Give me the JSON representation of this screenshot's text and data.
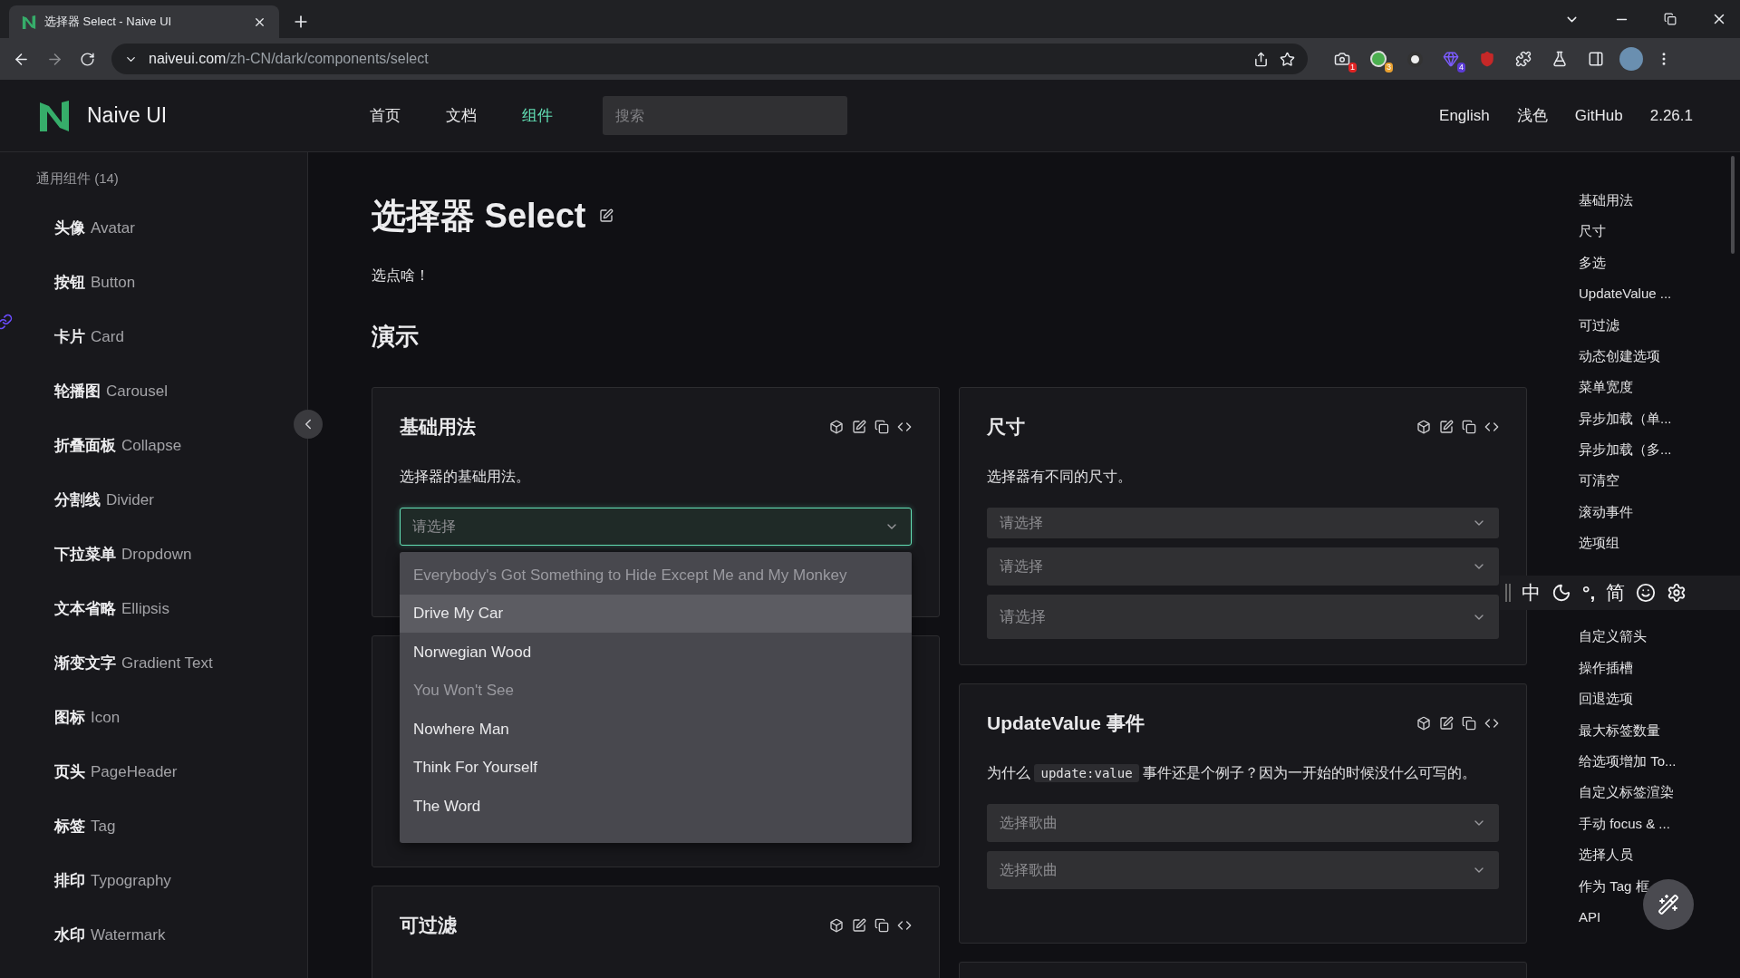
{
  "browser": {
    "tab_title": "选择器 Select - Naive UI",
    "url_host": "naiveui.com",
    "url_path": "/zh-CN/dark/components/select",
    "extensions": [
      {
        "kind": "camera",
        "badge": "1",
        "color": "#e02424"
      },
      {
        "kind": "ball",
        "badge": "3",
        "color": "#e8a030"
      },
      {
        "kind": "dot"
      },
      {
        "kind": "gem",
        "badge": "4",
        "color": "#5b3bd6"
      },
      {
        "kind": "shield"
      },
      {
        "kind": "puzzle"
      },
      {
        "kind": "flask"
      },
      {
        "kind": "panel"
      }
    ]
  },
  "header": {
    "logo": "Naive UI",
    "nav": [
      {
        "label": "首页",
        "selected": false
      },
      {
        "label": "文档",
        "selected": false
      },
      {
        "label": "组件",
        "selected": true
      }
    ],
    "search": {
      "placeholder": "搜索"
    },
    "links": [
      "English",
      "浅色",
      "GitHub",
      "2.26.1"
    ]
  },
  "sidebar": {
    "group": "通用组件 (14)",
    "items": [
      {
        "zh": "头像",
        "en": "Avatar"
      },
      {
        "zh": "按钮",
        "en": "Button"
      },
      {
        "zh": "卡片",
        "en": "Card"
      },
      {
        "zh": "轮播图",
        "en": "Carousel"
      },
      {
        "zh": "折叠面板",
        "en": "Collapse"
      },
      {
        "zh": "分割线",
        "en": "Divider"
      },
      {
        "zh": "下拉菜单",
        "en": "Dropdown"
      },
      {
        "zh": "文本省略",
        "en": "Ellipsis"
      },
      {
        "zh": "渐变文字",
        "en": "Gradient Text"
      },
      {
        "zh": "图标",
        "en": "Icon"
      },
      {
        "zh": "页头",
        "en": "PageHeader"
      },
      {
        "zh": "标签",
        "en": "Tag"
      },
      {
        "zh": "排印",
        "en": "Typography"
      },
      {
        "zh": "水印",
        "en": "Watermark"
      }
    ]
  },
  "page": {
    "title": "选择器 Select",
    "intro": "选点啥！",
    "section": "演示"
  },
  "demos": {
    "left": [
      {
        "kind": "demo",
        "title": "基础用法",
        "description": [
          {
            "kind": "text",
            "text": "选择器的基础用法。"
          }
        ],
        "fields": [
          {
            "placeholder": "请选择",
            "kind": "medium",
            "focused": true
          }
        ]
      },
      {
        "kind": "blank"
      },
      {
        "kind": "demo",
        "title": "可过滤"
      }
    ],
    "right": [
      {
        "kind": "demo",
        "title": "尺寸",
        "description": [
          {
            "kind": "text",
            "text": "选择器有不同的尺寸。"
          }
        ],
        "fields": [
          {
            "placeholder": "请选择",
            "kind": "small",
            "focused": false
          },
          {
            "placeholder": "请选择",
            "kind": "medium",
            "focused": false
          },
          {
            "placeholder": "请选择",
            "kind": "large",
            "focused": false
          }
        ]
      },
      {
        "kind": "demo",
        "title": "UpdateValue 事件",
        "description": [
          {
            "kind": "text",
            "text": "为什么 "
          },
          {
            "kind": "code",
            "text": "update:value"
          },
          {
            "kind": "text",
            "text": " 事件还是个例子？因为一开始的时候没什么可写的。"
          }
        ],
        "fields": [
          {
            "placeholder": "选择歌曲",
            "kind": "medium",
            "focused": false
          },
          {
            "placeholder": "选择歌曲",
            "kind": "medium",
            "focused": false
          }
        ]
      },
      {
        "kind": "blank"
      }
    ]
  },
  "dropdown": {
    "options": [
      {
        "label": "Everybody's Got Something to Hide Except Me and My Monkey",
        "disabled": true,
        "highlighted": false
      },
      {
        "label": "Drive My Car",
        "disabled": false,
        "highlighted": true
      },
      {
        "label": "Norwegian Wood",
        "disabled": false,
        "highlighted": false
      },
      {
        "label": "You Won't See",
        "disabled": true,
        "highlighted": false
      },
      {
        "label": "Nowhere Man",
        "disabled": false,
        "highlighted": false
      },
      {
        "label": "Think For Yourself",
        "disabled": false,
        "highlighted": false
      },
      {
        "label": "The Word",
        "disabled": false,
        "highlighted": false
      }
    ]
  },
  "toc": {
    "items_above": [
      "基础用法",
      "尺寸",
      "多选",
      "UpdateValue ...",
      "可过滤",
      "动态创建选项",
      "菜单宽度",
      "异步加载（单...",
      "异步加载（多...",
      "可清空",
      "滚动事件",
      "选项组"
    ],
    "items_below": [
      "自定义箭头",
      "操作插槽",
      "回退选项",
      "最大标签数量",
      "给选项增加 To...",
      "自定义标签渲染",
      "手动 focus & ...",
      "选择人员",
      "作为 Tag 框",
      "API"
    ]
  },
  "ime_toolbar": {
    "labels": [
      "中",
      "°,",
      "简"
    ]
  }
}
